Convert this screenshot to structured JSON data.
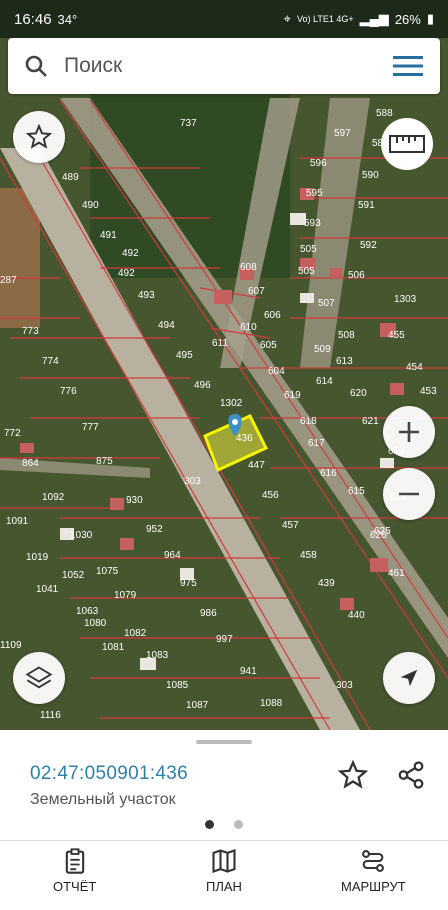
{
  "status_bar": {
    "time": "16:46",
    "temp": "34°",
    "network": "Vo) LTE1 4G+",
    "battery": "26%"
  },
  "search": {
    "placeholder": "Поиск"
  },
  "map": {
    "plot_labels": [
      "737",
      "489",
      "490",
      "491",
      "492",
      "492",
      "493",
      "494",
      "495",
      "496",
      "773",
      "774",
      "776",
      "777",
      "875",
      "864",
      "772",
      "1092",
      "1091",
      "303",
      "447",
      "456",
      "457",
      "458",
      "619",
      "620",
      "621",
      "617",
      "618",
      "616",
      "615",
      "614",
      "613",
      "597",
      "596",
      "595",
      "593",
      "590",
      "591",
      "592",
      "505",
      "505",
      "506",
      "507",
      "508",
      "509",
      "610",
      "611",
      "604",
      "605",
      "606",
      "607",
      "608",
      "1303",
      "455",
      "454",
      "453",
      "623",
      "624",
      "625",
      "626",
      "461",
      "1302",
      "930",
      "952",
      "964",
      "975",
      "986",
      "997",
      "941",
      "1088",
      "1087",
      "1085",
      "1083",
      "1082",
      "1081",
      "1080",
      "1079",
      "1075",
      "1063",
      "1052",
      "1041",
      "1019",
      "1030",
      "1116",
      "1109",
      "440",
      "439",
      "588",
      "589",
      "303",
      "287",
      "436"
    ],
    "selected_label": "436"
  },
  "sheet": {
    "cadastral_number": "02:47:050901:436",
    "object_type": "Земельный участок"
  },
  "nav": {
    "report": "ОТЧЁТ",
    "plan": "ПЛАН",
    "route": "МАРШРУТ"
  }
}
